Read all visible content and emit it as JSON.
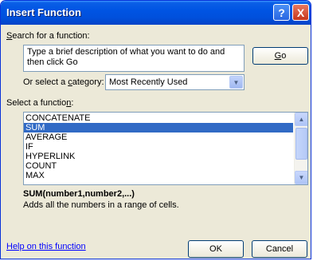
{
  "window": {
    "title": "Insert Function",
    "help_button": "?",
    "close_button": "X"
  },
  "search": {
    "label_prefix": "S",
    "label_rest": "earch for a function:",
    "description": "Type a brief description of what you want to do and then click Go",
    "go_button_key": "G",
    "go_button_rest": "o"
  },
  "category": {
    "label_prefix": "Or select a ",
    "label_key": "c",
    "label_rest": "ategory:",
    "selected": "Most Recently Used"
  },
  "functions": {
    "label_prefix": "Select a functio",
    "label_key": "n",
    "label_rest": ":",
    "items": [
      "CONCATENATE",
      "SUM",
      "AVERAGE",
      "IF",
      "HYPERLINK",
      "COUNT",
      "MAX"
    ],
    "selected_index": 1,
    "signature": "SUM(number1,number2,...)",
    "description": "Adds all the numbers in a range of cells."
  },
  "footer": {
    "help_link": "Help on this function",
    "ok_button": "OK",
    "cancel_button": "Cancel"
  },
  "colors": {
    "selection": "#316ac5",
    "titlebar": "#0054e3",
    "link": "#0000ff"
  },
  "icons": {
    "dropdown": "chevron-down-icon",
    "scroll_up": "chevron-up-icon",
    "scroll_down": "chevron-down-icon"
  }
}
